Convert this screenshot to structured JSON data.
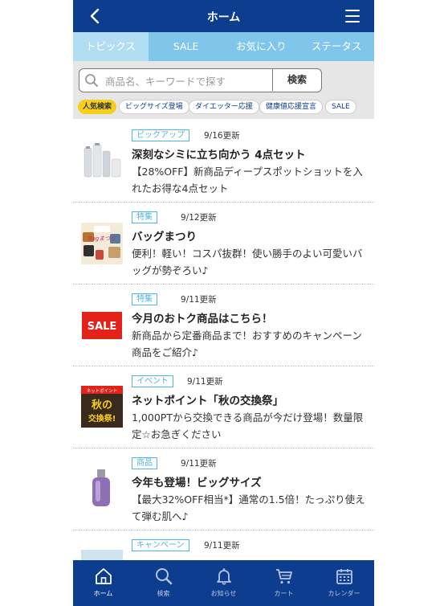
{
  "header": {
    "title": "ホーム"
  },
  "tabs": [
    {
      "label": "トピックス",
      "active": true
    },
    {
      "label": "SALE"
    },
    {
      "label": "お気に入り"
    },
    {
      "label": "ステータス"
    }
  ],
  "search": {
    "placeholder": "商品名、キーワードで探す",
    "button_label": "検索"
  },
  "tags": {
    "popular_label": "人気検索",
    "items": [
      "ビッグサイズ登場",
      "ダイエッター応援",
      "健康値応援宣言",
      "SALE"
    ]
  },
  "items": [
    {
      "badge": "ピックアップ",
      "date": "9/16更新",
      "title": "深刻なシミに立ち向かう 4点セット",
      "desc": "【28%OFF】新商品ディープスポットショットを入れたお得な4点セット"
    },
    {
      "badge": "特集",
      "date": "9/12更新",
      "title": "バッグまつり",
      "desc": "便利！軽い！コスパ抜群！使い勝手のよい可愛いバッグが勢ぞろい♪",
      "thumb_text": "Bagまつり"
    },
    {
      "badge": "特集",
      "date": "9/11更新",
      "title": "今月のおトク商品はこちら！",
      "desc": "新商品から定番商品まで！おすすめのキャンペーン商品をご紹介♪",
      "thumb_text": "SALE"
    },
    {
      "badge": "イベント",
      "date": "9/11更新",
      "title": "ネットポイント「秋の交換祭」",
      "desc": "1,000PTから交換できる商品が今だけ登場！数量限定☆お急ぎください",
      "thumb_text_1": "ネットポイント",
      "thumb_text_2": "秋の",
      "thumb_text_3": "交換祭!"
    },
    {
      "badge": "商品",
      "date": "9/11更新",
      "title": "今年も登場！ビッグサイズ",
      "desc": "【最大32%OFF相当*】通常の1.5倍！たっぷり使えて弾む肌へ♪"
    },
    {
      "badge": "キャンペーン",
      "date": "9/11更新"
    }
  ],
  "bottom_nav": [
    {
      "label": "ホーム",
      "icon": "home-icon"
    },
    {
      "label": "検索",
      "icon": "search-icon"
    },
    {
      "label": "お知らせ",
      "icon": "bell-icon"
    },
    {
      "label": "カート",
      "icon": "cart-icon"
    },
    {
      "label": "カレンダー",
      "icon": "calendar-icon"
    }
  ],
  "colors": {
    "header": "#0c3d8e",
    "tabs": "#7fc6ea",
    "tab_active": "#b2def3",
    "badge": "#4fb5e6",
    "popular": "#f6cf1c"
  }
}
